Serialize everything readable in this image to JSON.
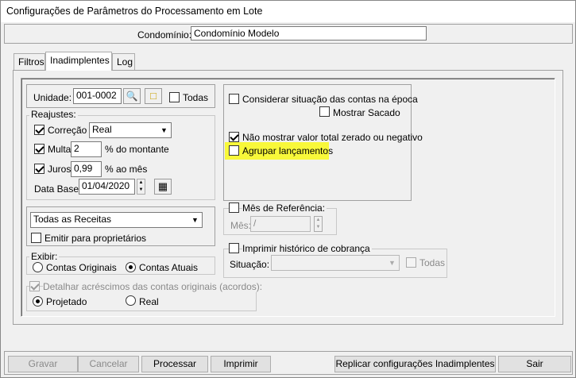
{
  "window": {
    "title": "Configurações de Parâmetros do Processamento em Lote"
  },
  "condominio": {
    "label": "Condomínio:",
    "value": "Condomínio Modelo"
  },
  "tabs": [
    {
      "label": "Filtros"
    },
    {
      "label": "Inadimplentes"
    },
    {
      "label": "Log"
    }
  ],
  "unidade": {
    "label": "Unidade:",
    "value": "001-0002",
    "todas_label": "Todas"
  },
  "reajustes": {
    "legend": "Reajustes:",
    "correcao_label": "Correção",
    "correcao_value": "Real",
    "multa_label": "Multa",
    "multa_value": "2",
    "multa_suffix": "% do montante",
    "juros_label": "Juros",
    "juros_value": "0,99",
    "juros_suffix": "% ao mês",
    "database_label": "Data Base:",
    "database_value": "01/04/2020"
  },
  "receitas": {
    "value": "Todas as Receitas",
    "emitir_label": "Emitir para proprietários"
  },
  "exibir": {
    "legend": "Exibir:",
    "originais": "Contas Originais",
    "atuais": "Contas Atuais"
  },
  "detalhar": {
    "label": "Detalhar acréscimos das contas originais (acordos):",
    "projetado": "Projetado",
    "real": "Real"
  },
  "options": {
    "considerar": "Considerar situação das contas na época",
    "mostrar_sacado": "Mostrar Sacado",
    "nao_mostrar": "Não mostrar valor total zerado ou negativo",
    "agrupar": "Agrupar lançamentos",
    "highlight_color": "#f8f83a"
  },
  "mes_referencia": {
    "label": "Mês de Referência:",
    "mes_label": "Mês:",
    "value": " /"
  },
  "historico": {
    "label": "Imprimir histórico de cobrança",
    "situacao_label": "Situação:",
    "todas_label": "Todas"
  },
  "buttons": {
    "gravar": "Gravar",
    "cancelar": "Cancelar",
    "processar": "Processar",
    "imprimir": "Imprimir",
    "replicar": "Replicar configurações Inadimplentes",
    "sair": "Sair"
  }
}
